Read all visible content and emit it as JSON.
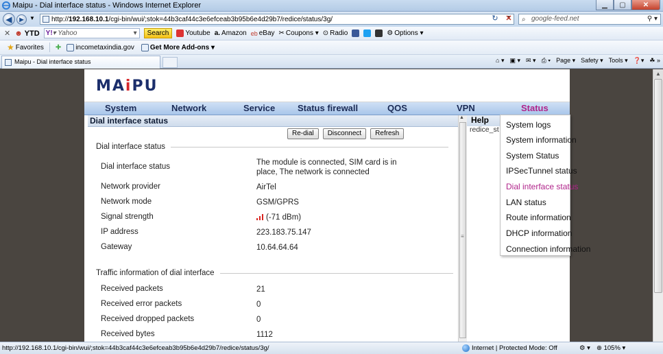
{
  "window": {
    "title": "Maipu - Dial interface status - Windows Internet Explorer",
    "controls": {
      "minimize": "▁",
      "maximize": "▢",
      "close": "✕"
    }
  },
  "address": {
    "url_prefix": "http://",
    "host": "192.168.10.1",
    "url_rest": "/cgi-bin/wui/;stok=44b3caf44c3e6efceab3b95b6e4d29b7/redice/status/3g/",
    "search_placeholder": "google-feed.net"
  },
  "toolbar": {
    "close": "✕",
    "ytd": "YTD",
    "yahoo_placeholder": "Yahoo",
    "search_btn": "Search",
    "youtube": "Youtube",
    "amazon": "Amazon",
    "ebay": "eBay",
    "coupons": "Coupons ▾",
    "radio": "Radio",
    "options": "Options ▾"
  },
  "favorites": {
    "label": "Favorites",
    "items": [
      "incometaxindia.gov",
      "Get More Add-ons ▾"
    ]
  },
  "tabs": [
    {
      "label": "Maipu - Dial interface status"
    }
  ],
  "commandbar": {
    "page": "Page ▾",
    "safety": "Safety ▾",
    "tools": "Tools ▾"
  },
  "site": {
    "logo": {
      "main": "MA",
      "dot_i": "i",
      "rest": "PU"
    },
    "nav": [
      "System",
      "Network",
      "Service",
      "Status firewall",
      "QOS",
      "VPN",
      "Status"
    ],
    "content_title": "Dial interface status",
    "actions": [
      "Re-dial",
      "Disconnect",
      "Refresh"
    ],
    "section1": {
      "legend": "Dial interface status",
      "rows": [
        {
          "label": "Dial interface status",
          "value": "The module is connected, SIM card is in place, The network is connected"
        },
        {
          "label": "Network provider",
          "value": "AirTel"
        },
        {
          "label": "Network mode",
          "value": "GSM/GPRS"
        },
        {
          "label": "Signal strength",
          "value": "(-71 dBm)"
        },
        {
          "label": "IP address",
          "value": "223.183.75.147"
        },
        {
          "label": "Gateway",
          "value": "10.64.64.64"
        }
      ]
    },
    "section2": {
      "legend": "Traffic information of dial interface",
      "rows": [
        {
          "label": "Received packets",
          "value": "21"
        },
        {
          "label": "Received error packets",
          "value": "0"
        },
        {
          "label": "Received dropped packets",
          "value": "0"
        },
        {
          "label": "Received bytes",
          "value": "1112"
        }
      ]
    },
    "help": {
      "title": "Help",
      "text": "redice_st"
    },
    "status_menu": [
      "System logs",
      "System information",
      "System Status",
      "IPSecTunnel status",
      "Dial interface status",
      "LAN status",
      "Route information",
      "DHCP information",
      "Connection information"
    ],
    "active_menu_index": 4
  },
  "statusbar": {
    "url": "http://192.168.10.1/cgi-bin/wui/;stok=44b3caf44c3e6efceab3b95b6e4d29b7/redice/status/3g/",
    "zone": "Internet | Protected Mode: Off",
    "zoom": "105%"
  },
  "colors": {
    "accent_status": "#b0238a",
    "brand_navy": "#1b2e6b",
    "signal_red": "#d8231e"
  }
}
